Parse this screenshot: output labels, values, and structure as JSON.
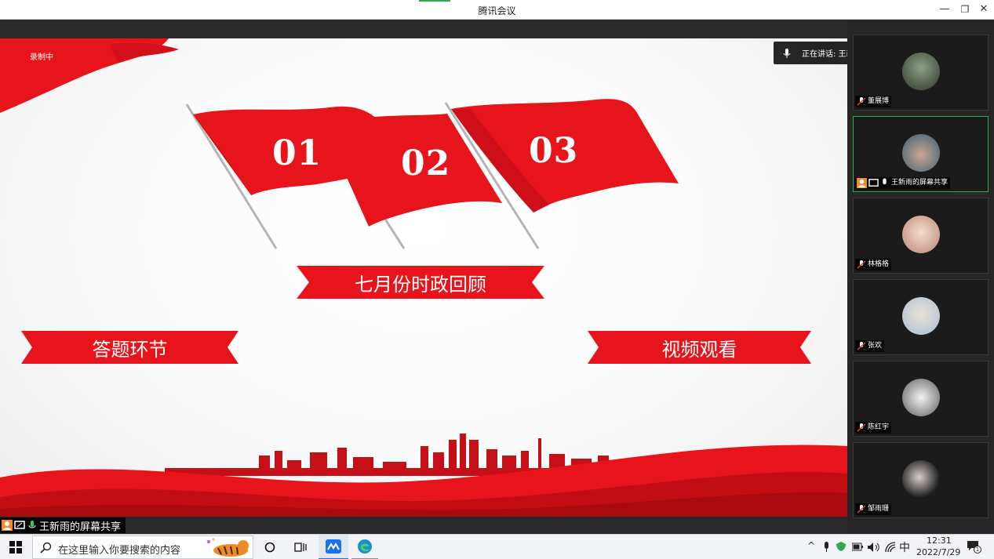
{
  "window": {
    "title": "腾讯会议",
    "minimize_glyph": "—",
    "restore_glyph": "❐",
    "close_glyph": "✕"
  },
  "slide": {
    "recording_label": "录制中",
    "flags": [
      "01",
      "02",
      "03"
    ],
    "center_banner": "七月份时政回顾",
    "left_banner": "答题环节",
    "right_banner": "视频观看",
    "colors": {
      "red": "#e8141c",
      "dark_red": "#b80c12"
    }
  },
  "speaking_indicator": {
    "text": "正在讲话: 王新雨;"
  },
  "share_label": "王新雨的屏幕共享",
  "participants": [
    {
      "name": "董展博",
      "avatar": "cartoon-avatar"
    },
    {
      "name": "王新雨的屏幕共享",
      "avatar": "photo-avatar",
      "active": true
    },
    {
      "name": "林格格",
      "avatar": "anime-girl-avatar"
    },
    {
      "name": "张欢",
      "avatar": "girl-avatar"
    },
    {
      "name": "陈红宇",
      "avatar": "sketch-avatar"
    },
    {
      "name": "邹雨珊",
      "avatar": "dark-hair-avatar"
    }
  ],
  "taskbar": {
    "search_placeholder": "在这里输入你要搜索的内容",
    "ime": "中",
    "time": "12:31",
    "date": "2022/7/29",
    "notification_count": "1"
  }
}
